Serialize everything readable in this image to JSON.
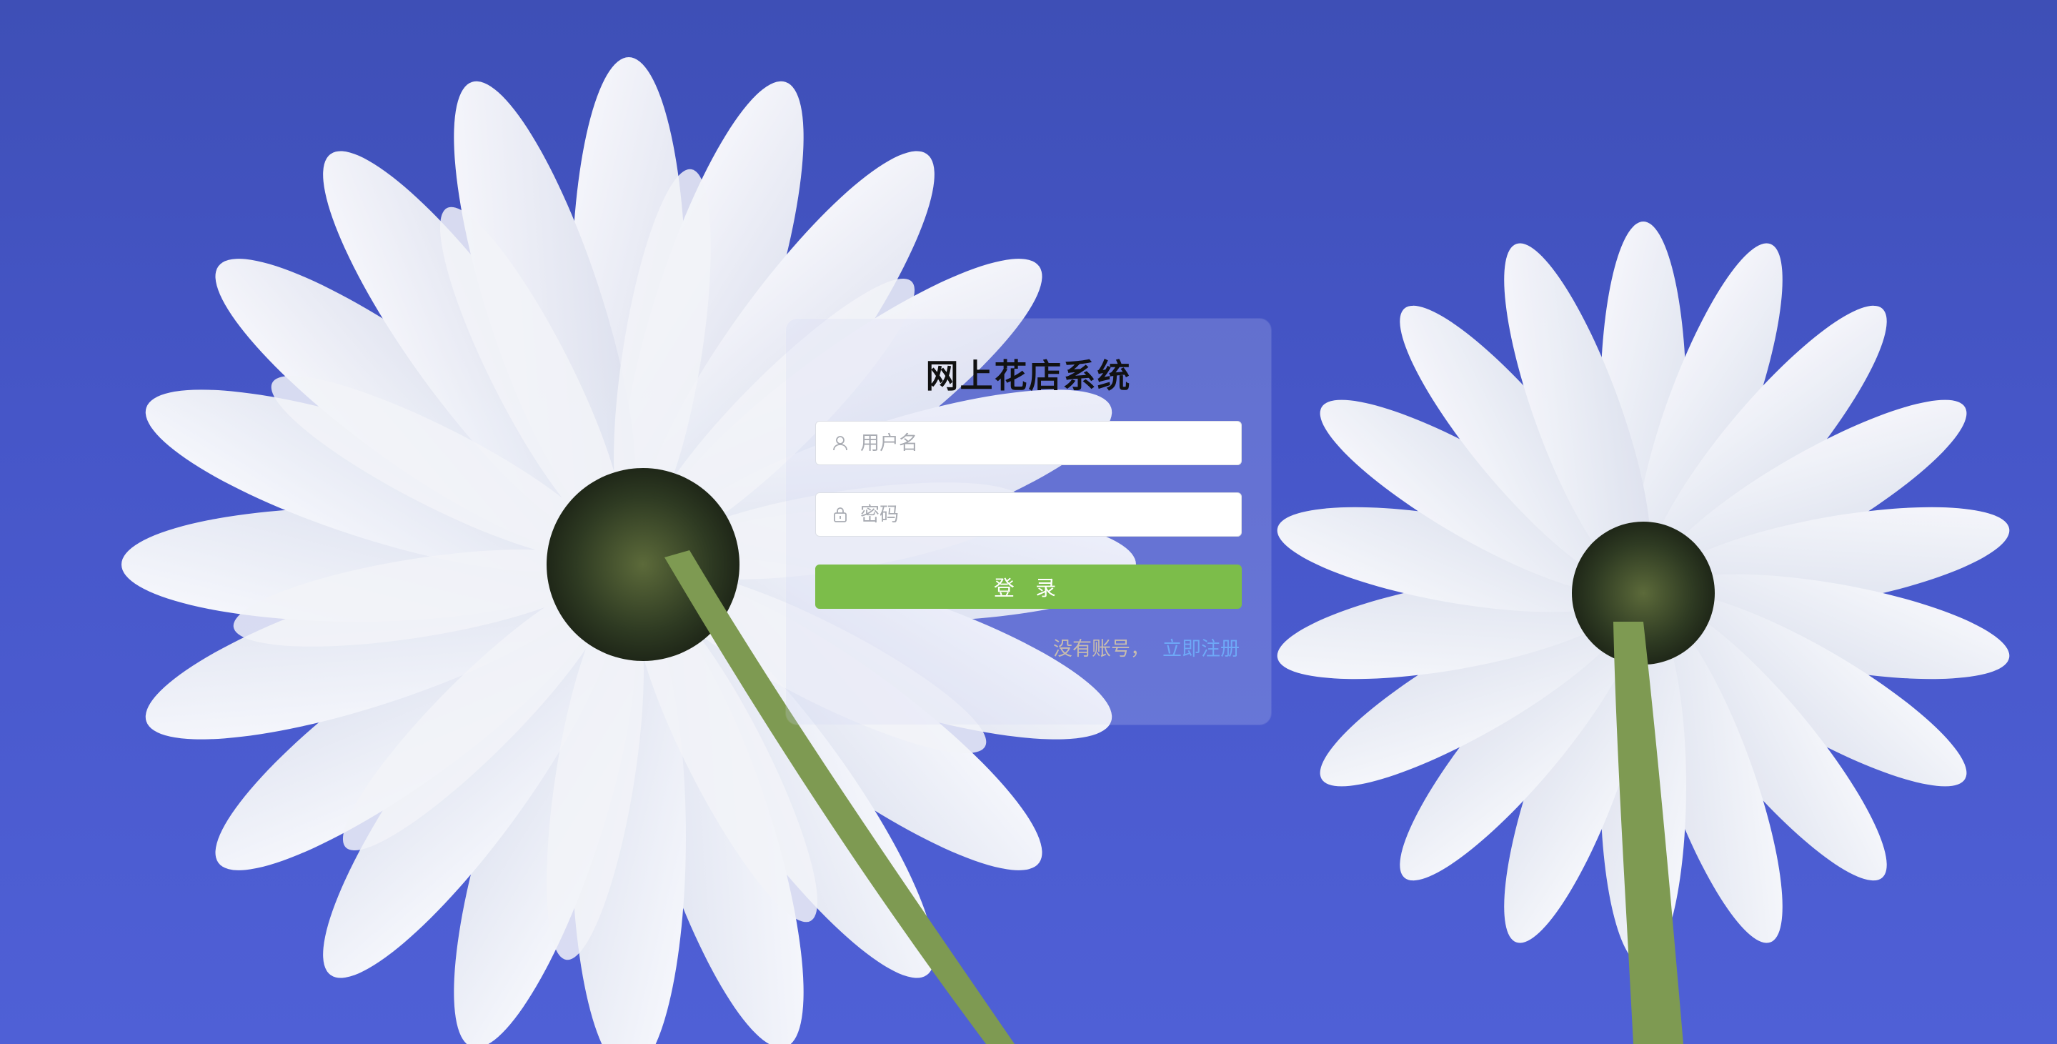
{
  "login": {
    "title": "网上花店系统",
    "username_placeholder": "用户名",
    "password_placeholder": "密码",
    "login_button": "登 录",
    "register_hint": "没有账号，",
    "register_link": "立即注册"
  },
  "icons": {
    "username": "user-icon",
    "password": "lock-icon"
  },
  "colors": {
    "sky": "#4656c8",
    "login_button": "#7cbd4a",
    "register_link": "#6ea8f7",
    "register_hint": "#c7bcae"
  }
}
